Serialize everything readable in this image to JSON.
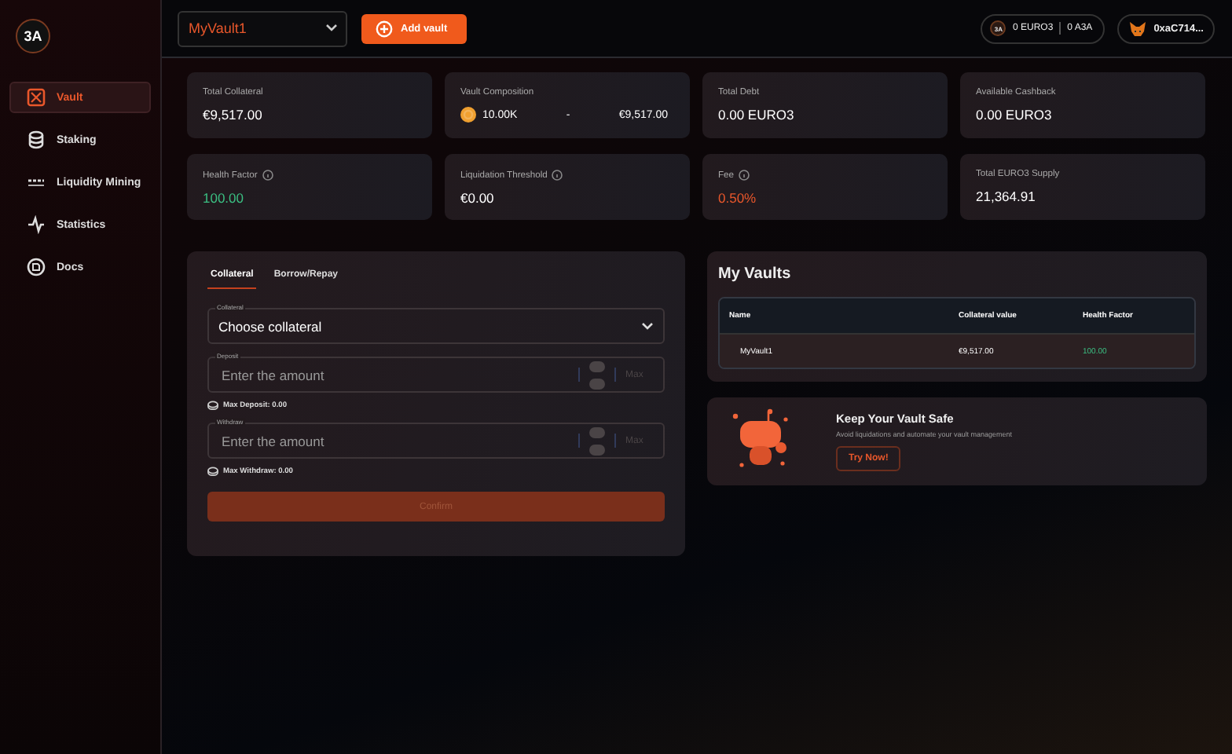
{
  "logo": "3A",
  "sidebar": {
    "items": [
      {
        "label": "Vault",
        "selected": true
      },
      {
        "label": "Staking",
        "selected": false
      },
      {
        "label": "Liquidity Mining",
        "selected": false
      },
      {
        "label": "Statistics",
        "selected": false
      },
      {
        "label": "Docs",
        "selected": false
      }
    ]
  },
  "topbar": {
    "vault_select": "MyVault1",
    "add_button": "Add vault",
    "balance_badge": "3A",
    "balances": [
      "0 EURO3",
      "0 A3A"
    ],
    "wallet": "0xaC714..."
  },
  "stats": [
    {
      "label": "Total Collateral",
      "value": "€9,517.00",
      "color": "#ffffff",
      "info": false,
      "kind": "value"
    },
    {
      "label": "Vault Composition",
      "kind": "composition",
      "amount": "10.00K",
      "separator": "-",
      "value": "€9,517.00",
      "color": "#ffffff",
      "info": false
    },
    {
      "label": "Total Debt",
      "value": "0.00 EURO3",
      "color": "#ffffff",
      "info": false,
      "kind": "value"
    },
    {
      "label": "Available Cashback",
      "value": "0.00 EURO3",
      "color": "#ffffff",
      "info": false,
      "kind": "value"
    },
    {
      "label": "Health Factor",
      "value": "100.00",
      "color": "#3bbf82",
      "info": true,
      "kind": "value"
    },
    {
      "label": "Liquidation Threshold",
      "value": "€0.00",
      "color": "#ffffff",
      "info": true,
      "kind": "value"
    },
    {
      "label": "Fee",
      "value": "0.50%",
      "color": "#e9572b",
      "info": true,
      "kind": "value"
    },
    {
      "label": "Total EURO3 Supply",
      "value": "21,364.91",
      "color": "#ffffff",
      "info": false,
      "kind": "value"
    }
  ],
  "form": {
    "tabs": [
      {
        "label": "Collateral",
        "selected": true
      },
      {
        "label": "Borrow/Repay",
        "selected": false
      }
    ],
    "fields": [
      {
        "kind": "select",
        "label": "Collateral",
        "value": "Choose collateral"
      },
      {
        "kind": "amount",
        "label": "Deposit",
        "placeholder": "Enter the amount",
        "max_button": "Max",
        "note": "Max Deposit: 0.00"
      },
      {
        "kind": "amount",
        "label": "Withdraw",
        "placeholder": "Enter the amount",
        "max_button": "Max",
        "note": "Max Withdraw: 0.00"
      }
    ],
    "confirm": {
      "label": "Confirm",
      "disabled": true
    }
  },
  "vaults": {
    "title": "My Vaults",
    "columns": [
      "Name",
      "Collateral value",
      "Health Factor"
    ],
    "rows": [
      {
        "name": "MyVault1",
        "collateral": "€9,517.00",
        "health": "100.00"
      }
    ]
  },
  "promo": {
    "title": "Keep Your Vault Safe",
    "text": "Avoid liquidations and automate your vault management",
    "button": "Try Now!"
  }
}
